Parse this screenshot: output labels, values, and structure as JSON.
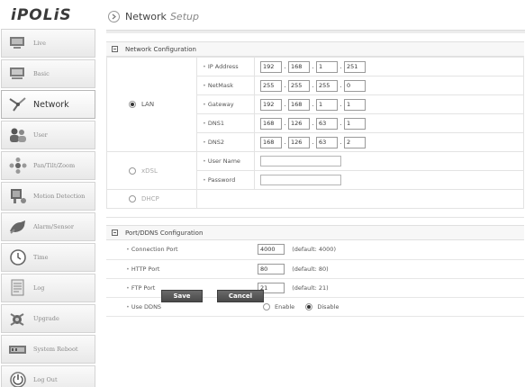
{
  "app": {
    "logo": "iPOLiS"
  },
  "header": {
    "title": "Network",
    "subtitle": "Setup"
  },
  "sidebar": {
    "items": [
      {
        "label": "Live",
        "icon": "monitor-icon"
      },
      {
        "label": "Basic",
        "icon": "monitor-icon"
      },
      {
        "label": "Network",
        "icon": "network-icon",
        "active": true
      },
      {
        "label": "User",
        "icon": "users-icon"
      },
      {
        "label": "Pan/Tilt/Zoom",
        "icon": "ptz-icon"
      },
      {
        "label": "Motion Detection",
        "icon": "motion-icon"
      },
      {
        "label": "Alarm/Sensor",
        "icon": "alarm-icon"
      },
      {
        "label": "Time",
        "icon": "clock-icon"
      },
      {
        "label": "Log",
        "icon": "log-icon"
      },
      {
        "label": "Upgrade",
        "icon": "upgrade-icon"
      },
      {
        "label": "System Reboot",
        "icon": "reboot-icon"
      },
      {
        "label": "Log Out",
        "icon": "logout-icon"
      }
    ]
  },
  "network_config": {
    "title": "Network Configuration",
    "lan": {
      "label": "LAN",
      "selected": true,
      "fields": [
        {
          "label": "IP Address",
          "value": [
            "192",
            "168",
            "1",
            "251"
          ]
        },
        {
          "label": "NetMask",
          "value": [
            "255",
            "255",
            "255",
            "0"
          ]
        },
        {
          "label": "Gateway",
          "value": [
            "192",
            "168",
            "1",
            "1"
          ]
        },
        {
          "label": "DNS1",
          "value": [
            "168",
            "126",
            "63",
            "1"
          ]
        },
        {
          "label": "DNS2",
          "value": [
            "168",
            "126",
            "63",
            "2"
          ]
        }
      ]
    },
    "xdsl": {
      "label": "xDSL",
      "selected": false,
      "user_name_label": "User Name",
      "password_label": "Password",
      "user_name_value": "",
      "password_value": ""
    },
    "dhcp": {
      "label": "DHCP",
      "selected": false
    }
  },
  "port_config": {
    "title": "Port/DDNS Configuration",
    "connection_port": {
      "label": "Connection Port",
      "value": "4000",
      "default": "(default: 4000)"
    },
    "http_port": {
      "label": "HTTP Port",
      "value": "80",
      "default": "(default: 80)"
    },
    "ftp_port": {
      "label": "FTP Port",
      "value": "21",
      "default": "(default: 21)"
    },
    "ddns": {
      "label": "Use DDNS",
      "enable_label": "Enable",
      "disable_label": "Disable",
      "selected": "Disable"
    }
  },
  "buttons": {
    "save": "Save",
    "cancel": "Cancel"
  }
}
